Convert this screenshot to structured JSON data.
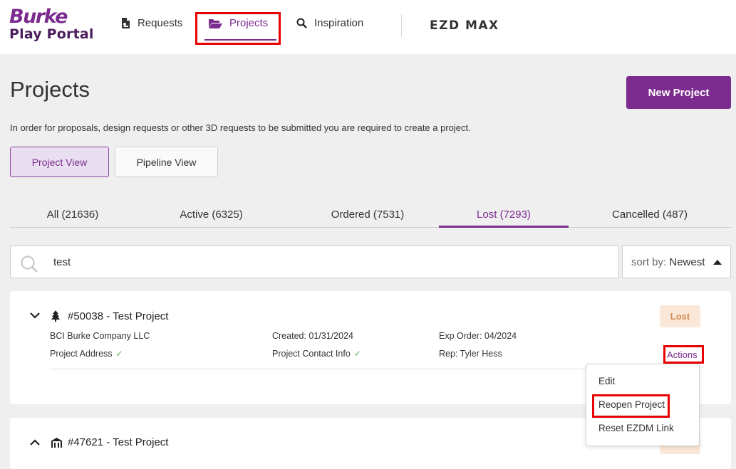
{
  "app": {
    "logo_line1": "Burke",
    "logo_line2": "Play Portal"
  },
  "nav": {
    "requests": "Requests",
    "projects": "Projects",
    "inspiration": "Inspiration",
    "ezd": "EZD MAX"
  },
  "page": {
    "title": "Projects",
    "new_project": "New Project",
    "intro": "In order for proposals, design requests or other 3D requests to be submitted you are required to create a project.",
    "view_project": "Project View",
    "view_pipeline": "Pipeline View"
  },
  "tabs": [
    {
      "label": "All (21636)"
    },
    {
      "label": "Active (6325)"
    },
    {
      "label": "Ordered (7531)"
    },
    {
      "label": "Lost (7293)",
      "selected": true
    },
    {
      "label": "Cancelled (487)"
    }
  ],
  "search": {
    "value": "test",
    "sort_label": "sort by:",
    "sort_value": "Newest"
  },
  "projects": [
    {
      "title": "#50038 - Test Project",
      "status": "Lost",
      "company": "BCI Burke Company LLC",
      "address": "Project Address",
      "created": "Created: 01/31/2024",
      "contact": "Project Contact Info",
      "exp_order": "Exp Order: 04/2024",
      "rep": "Rep: Tyler Hess",
      "actions": "Actions"
    },
    {
      "title": "#47621 - Test Project"
    }
  ],
  "actions_menu": {
    "edit": "Edit",
    "reopen": "Reopen Project",
    "reset": "Reset EZDM Link"
  },
  "colors": {
    "brand": "#7b2c8e",
    "lost_badge_bg": "#fbe8d8",
    "lost_badge_text": "#d58b53",
    "highlight": "#e60000"
  }
}
